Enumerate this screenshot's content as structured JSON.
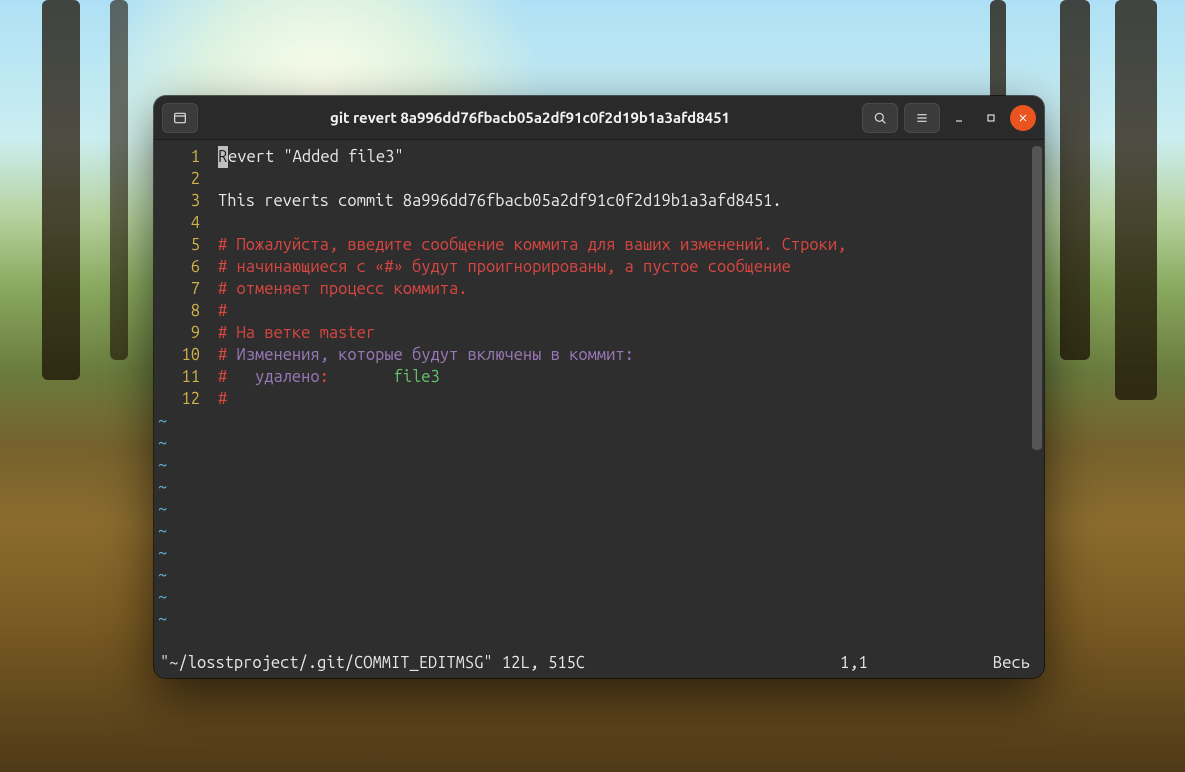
{
  "titlebar": {
    "title": "git revert 8a996dd76fbacb05a2df91c0f2d19b1a3afd8451"
  },
  "editor": {
    "lines": [
      {
        "num": "1",
        "segments": [
          {
            "t": "R",
            "cls": "cursor"
          },
          {
            "t": "evert \"Added file3\"",
            "cls": "white"
          }
        ]
      },
      {
        "num": "2",
        "segments": []
      },
      {
        "num": "3",
        "segments": [
          {
            "t": "This reverts commit 8a996dd76fbacb05a2df91c0f2d19b1a3afd8451.",
            "cls": "white"
          }
        ]
      },
      {
        "num": "4",
        "segments": []
      },
      {
        "num": "5",
        "segments": [
          {
            "t": "# Пожалуйста, введите сообщение коммита для ваших изменений. Строки,",
            "cls": "red"
          }
        ]
      },
      {
        "num": "6",
        "segments": [
          {
            "t": "# начинающиеся с «#» будут проигнорированы, а пустое сообщение",
            "cls": "red"
          }
        ]
      },
      {
        "num": "7",
        "segments": [
          {
            "t": "# отменяет процесс коммита.",
            "cls": "red"
          }
        ]
      },
      {
        "num": "8",
        "segments": [
          {
            "t": "#",
            "cls": "red"
          }
        ]
      },
      {
        "num": "9",
        "segments": [
          {
            "t": "# На ветке master",
            "cls": "red"
          }
        ]
      },
      {
        "num": "10",
        "segments": [
          {
            "t": "#",
            "cls": "red"
          },
          {
            "t": " Изменения, которые будут включены в коммит:",
            "cls": "purple"
          }
        ]
      },
      {
        "num": "11",
        "segments": [
          {
            "t": "#",
            "cls": "red"
          },
          {
            "t": "   удалено",
            "cls": "purple"
          },
          {
            "t": ":",
            "cls": "red"
          },
          {
            "t": "       file3",
            "cls": "green"
          }
        ]
      },
      {
        "num": "12",
        "segments": [
          {
            "t": "#",
            "cls": "red"
          }
        ]
      }
    ],
    "tilde_count": 10,
    "tilde_char": "~"
  },
  "statusbar": {
    "file": "\"~/losstproject/.git/COMMIT_EDITMSG\" 12L, 515C",
    "position": "1,1",
    "percent": "Весь"
  }
}
